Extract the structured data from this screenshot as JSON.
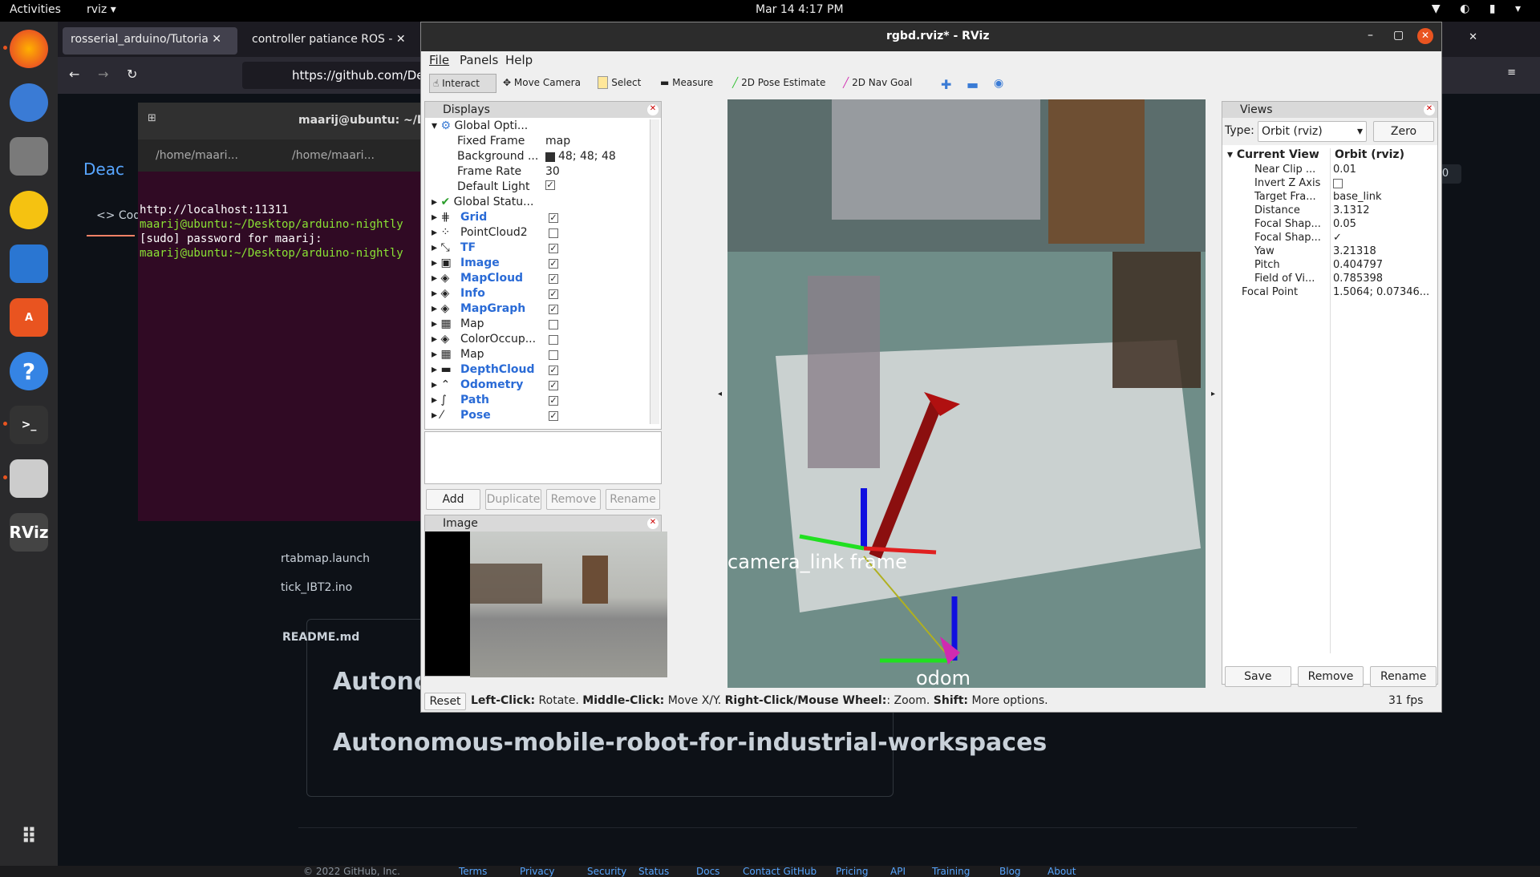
{
  "topbar": {
    "activities": "Activities",
    "app": "rviz ▾",
    "clock": "Mar 14  4:17 PM"
  },
  "firefox": {
    "tabs": [
      "rosserial_arduino/Tutoria",
      "controller patiance ROS -"
    ],
    "url": "https://github.com/De",
    "repo_title": "Deac",
    "code_tab": "<> Code",
    "files": [
      "rtabmap.launch",
      "tick_IBT2.ino"
    ],
    "readme": "README.md",
    "h1": "Autono",
    "h2": "Autonomous-mobile-robot-for-industrial-workspaces",
    "counter": "0",
    "footer": {
      "copyright": "© 2022 GitHub, Inc.",
      "links": [
        "Terms",
        "Privacy",
        "Security",
        "Status",
        "Docs",
        "Contact GitHub",
        "Pricing",
        "API",
        "Training",
        "Blog",
        "About"
      ]
    }
  },
  "terminal": {
    "title": "maarij@ubuntu: ~/De",
    "tabs": [
      "/home/maari...",
      "/home/maari..."
    ],
    "lines": [
      "http://localhost:11311",
      "maarij@ubuntu:~/Desktop/arduino-nightly",
      "[sudo] password for maarij:",
      "maarij@ubuntu:~/Desktop/arduino-nightly"
    ]
  },
  "rviz": {
    "title": "rgbd.rviz* - RViz",
    "menu": [
      "File",
      "Panels",
      "Help"
    ],
    "tools": [
      "Interact",
      "Move Camera",
      "Select",
      "Measure",
      "2D Pose Estimate",
      "2D Nav Goal"
    ],
    "displays": {
      "title": "Displays",
      "global_options": "Global Opti...",
      "options": [
        {
          "k": "Fixed Frame",
          "v": "map"
        },
        {
          "k": "Background ...",
          "v": "48; 48; 48"
        },
        {
          "k": "Frame Rate",
          "v": "30"
        },
        {
          "k": "Default Light",
          "v": "✓"
        }
      ],
      "global_status": "Global Statu...",
      "items": [
        {
          "name": "Grid",
          "checked": true,
          "active": true
        },
        {
          "name": "PointCloud2",
          "checked": false,
          "active": false
        },
        {
          "name": "TF",
          "checked": true,
          "active": true
        },
        {
          "name": "Image",
          "checked": true,
          "active": true
        },
        {
          "name": "MapCloud",
          "checked": true,
          "active": true
        },
        {
          "name": "Info",
          "checked": true,
          "active": true
        },
        {
          "name": "MapGraph",
          "checked": true,
          "active": true
        },
        {
          "name": "Map",
          "checked": false,
          "active": false
        },
        {
          "name": "ColorOccup...",
          "checked": false,
          "active": false
        },
        {
          "name": "Map",
          "checked": false,
          "active": false
        },
        {
          "name": "DepthCloud",
          "checked": true,
          "active": true
        },
        {
          "name": "Odometry",
          "checked": true,
          "active": true
        },
        {
          "name": "Path",
          "checked": true,
          "active": true
        },
        {
          "name": "Pose",
          "checked": true,
          "active": true
        }
      ],
      "buttons": [
        "Add",
        "Duplicate",
        "Remove",
        "Rename"
      ]
    },
    "image_panel": "Image",
    "views": {
      "title": "Views",
      "type_label": "Type:",
      "type_value": "Orbit (rviz)",
      "zero": "Zero",
      "current_view": "Current View",
      "current_value": "Orbit (rviz)",
      "props": [
        {
          "k": "Near Clip ...",
          "v": "0.01"
        },
        {
          "k": "Invert Z Axis",
          "v": ""
        },
        {
          "k": "Target Fra...",
          "v": "base_link"
        },
        {
          "k": "Distance",
          "v": "3.1312"
        },
        {
          "k": "Focal Shap...",
          "v": "0.05"
        },
        {
          "k": "Focal Shap...",
          "v": "✓"
        },
        {
          "k": "Yaw",
          "v": "3.21318"
        },
        {
          "k": "Pitch",
          "v": "0.404797"
        },
        {
          "k": "Field of Vi...",
          "v": "0.785398"
        },
        {
          "k": "Focal Point",
          "v": "1.5064; 0.07346..."
        }
      ],
      "buttons": [
        "Save",
        "Remove",
        "Rename"
      ]
    },
    "status": {
      "reset": "Reset",
      "left": "Left-Click:",
      "left_t": "Rotate.",
      "middle": "Middle-Click:",
      "middle_t": "Move X/Y.",
      "right": "Right-Click/Mouse Wheel:",
      "right_t": ": Zoom.",
      "shift": "Shift:",
      "shift_t": "More options.",
      "fps": "31 fps"
    },
    "scene_labels": [
      "camera_link frame",
      "odom"
    ]
  },
  "colors": {
    "ubuntu_orange": "#e95420",
    "terminal_bg": "#300a24",
    "rviz_grid": "#6f8d88"
  }
}
